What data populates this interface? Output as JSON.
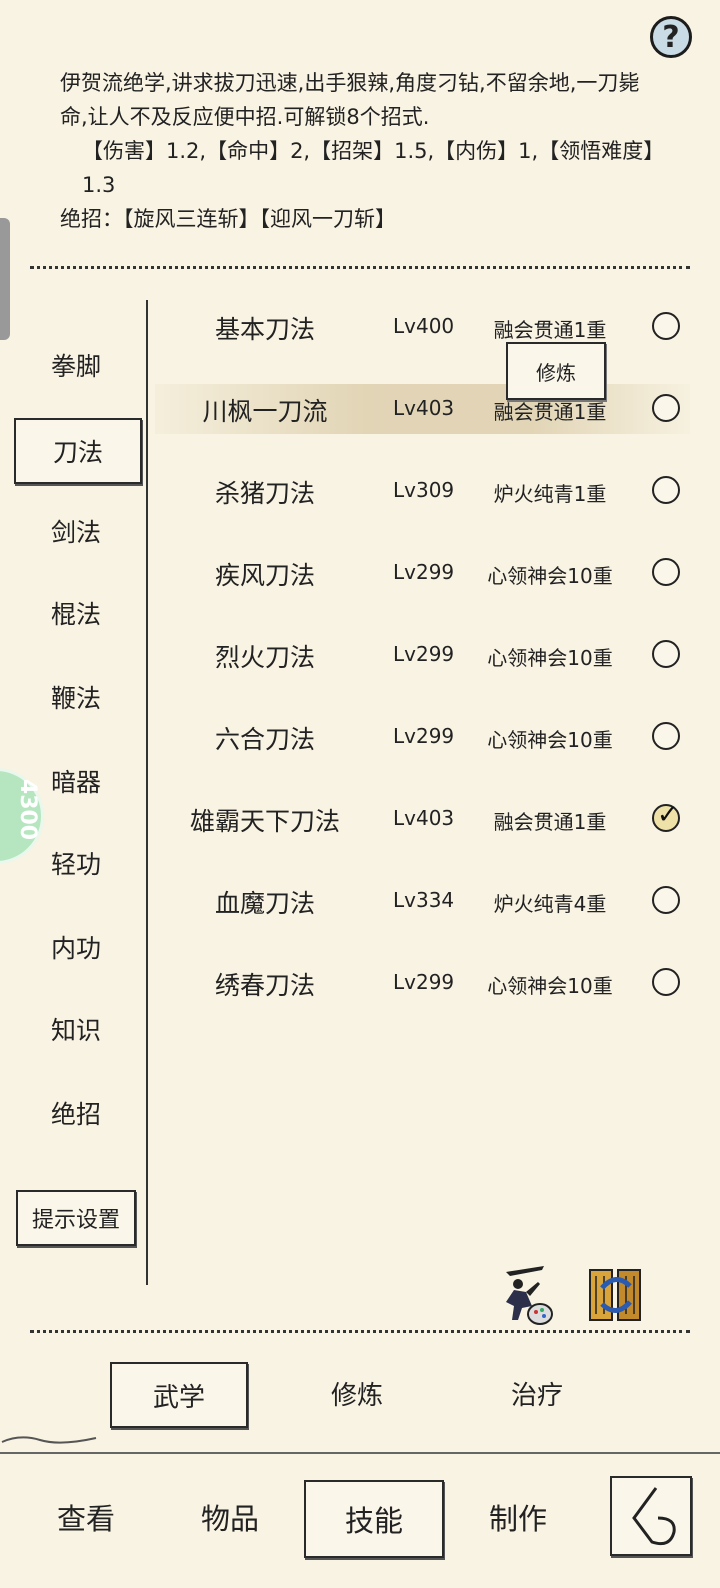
{
  "help": {
    "label": "?"
  },
  "description": {
    "line1": "伊贺流绝学,讲求拔刀迅速,出手狠辣,角度刁钻,不留余地,一刀毙命,让人不及反应便中招.可解锁8个招式.",
    "line2": "【伤害】1.2,【命中】2,【招架】1.5,【内伤】1,【领悟难度】1.3",
    "line3": "绝招：【旋风三连斩】【迎风一刀斩】"
  },
  "side_badge": {
    "text": "4300"
  },
  "categories": [
    {
      "label": "拳脚"
    },
    {
      "label": "刀法"
    },
    {
      "label": "剑法"
    },
    {
      "label": "棍法"
    },
    {
      "label": "鞭法"
    },
    {
      "label": "暗器"
    },
    {
      "label": "轻功"
    },
    {
      "label": "内功"
    },
    {
      "label": "知识"
    },
    {
      "label": "绝招"
    }
  ],
  "hint_settings": {
    "label": "提示设置"
  },
  "train_popup": {
    "label": "修炼"
  },
  "skills": [
    {
      "name": "基本刀法",
      "level": "Lv400",
      "rank": "融会贯通1重",
      "checked": false
    },
    {
      "name": "川枫一刀流",
      "level": "Lv403",
      "rank": "融会贯通1重",
      "checked": false
    },
    {
      "name": "杀猪刀法",
      "level": "Lv309",
      "rank": "炉火纯青1重",
      "checked": false
    },
    {
      "name": "疾风刀法",
      "level": "Lv299",
      "rank": "心领神会10重",
      "checked": false
    },
    {
      "name": "烈火刀法",
      "level": "Lv299",
      "rank": "心领神会10重",
      "checked": false
    },
    {
      "name": "六合刀法",
      "level": "Lv299",
      "rank": "心领神会10重",
      "checked": false
    },
    {
      "name": "雄霸天下刀法",
      "level": "Lv403",
      "rank": "融会贯通1重",
      "checked": true
    },
    {
      "name": "血魔刀法",
      "level": "Lv334",
      "rank": "炉火纯青4重",
      "checked": false
    },
    {
      "name": "绣春刀法",
      "level": "Lv299",
      "rank": "心领神会10重",
      "checked": false
    }
  ],
  "subtabs": [
    {
      "label": "武学"
    },
    {
      "label": "修炼"
    },
    {
      "label": "治疗"
    }
  ],
  "nav": [
    {
      "label": "查看"
    },
    {
      "label": "物品"
    },
    {
      "label": "技能"
    },
    {
      "label": "制作"
    }
  ]
}
